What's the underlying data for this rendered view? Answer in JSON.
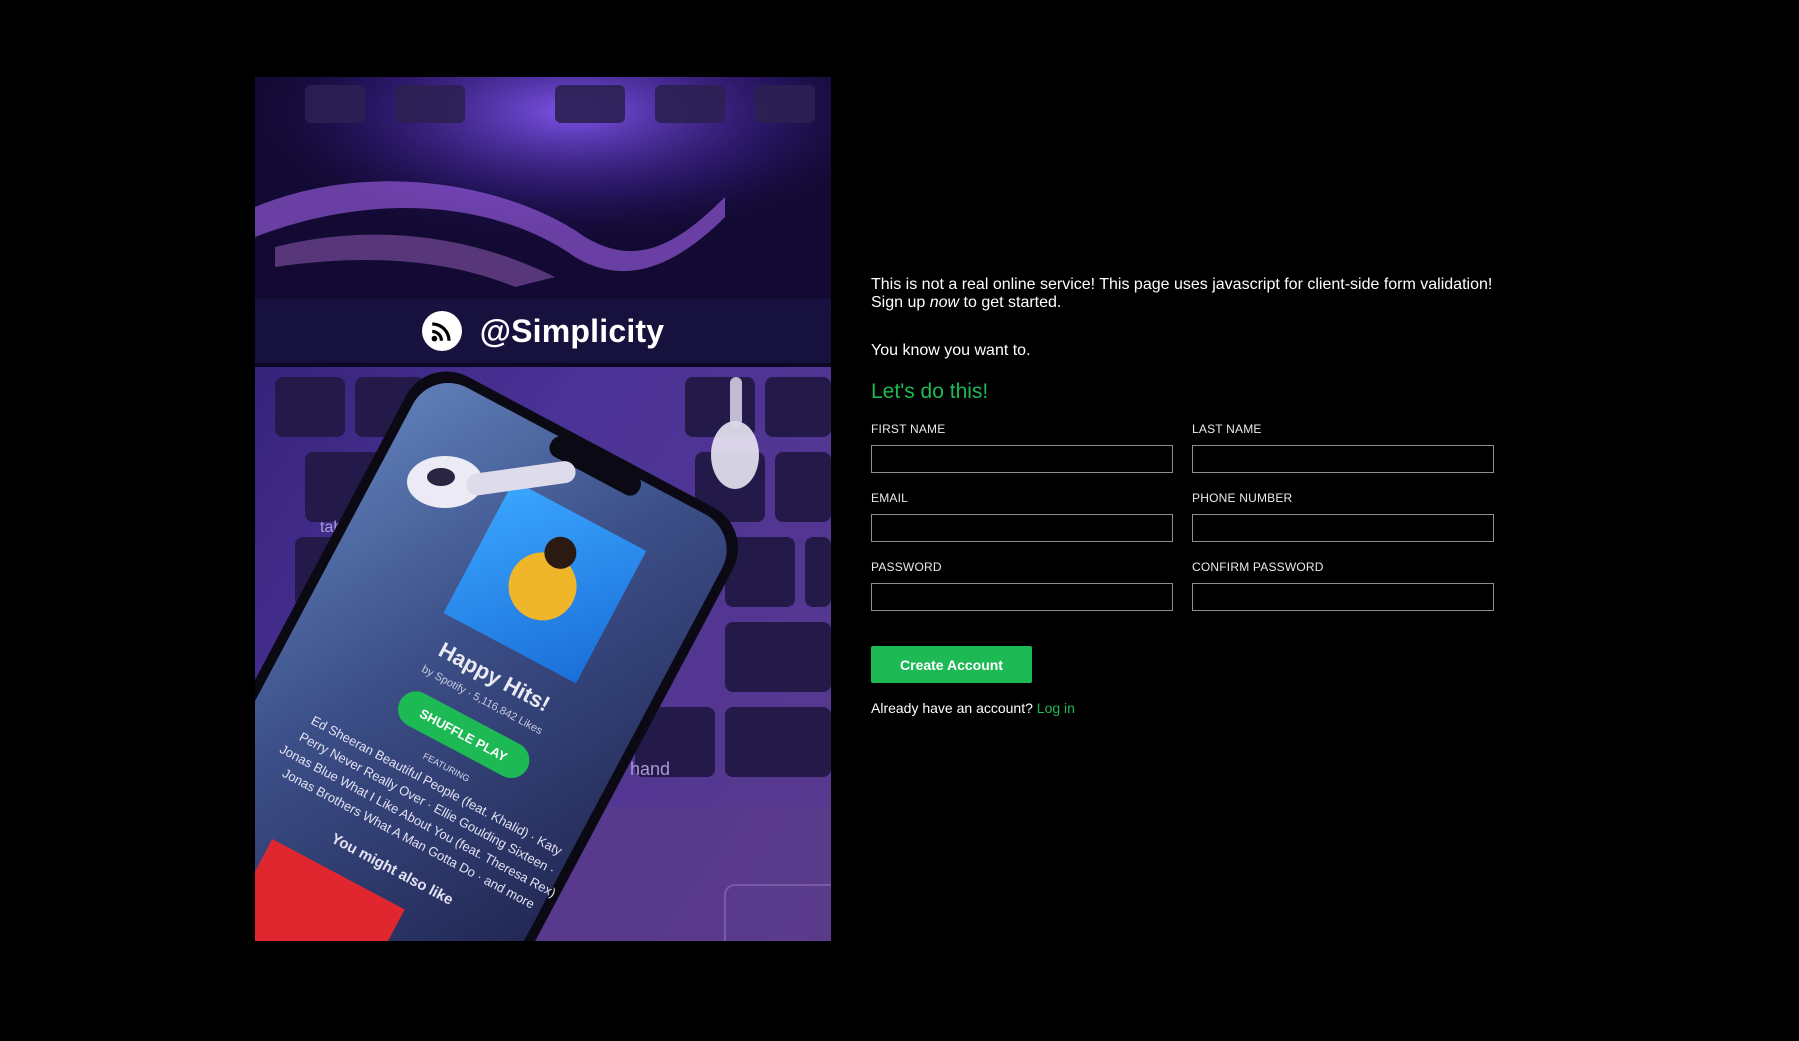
{
  "brand": {
    "logo_icon": "rss-feed-icon",
    "name": "@Simplicity"
  },
  "hero": {
    "image_icon": "phone-with-music-app-on-keyboard-image",
    "phone_playlist_title": "Happy Hits!",
    "phone_playlist_sub": "by Spotify · 5,116,842 Likes",
    "phone_button": "SHUFFLE PLAY",
    "phone_featuring": "FEATURING",
    "phone_tracks": [
      "Ed Sheeran Beautiful People (feat. Khalid) · Katy",
      "Perry Never Really Over · Ellie Goulding Sixteen ·",
      "Jonas Blue What I Like About You (feat. Theresa Rex)",
      "Jonas Brothers What A Man Gotta Do · and more"
    ],
    "phone_more": "You might also like",
    "key_labels": [
      "tab",
      "hand"
    ]
  },
  "intro": {
    "line1": "This is not a real online service! This page uses javascript for client-side form validation!",
    "line2_before": "Sign up ",
    "line2_em": "now",
    "line2_after": " to get started."
  },
  "intro2": "You know you want to.",
  "cta_title": "Let's do this!",
  "form": {
    "first_name": {
      "label": "FIRST NAME",
      "value": ""
    },
    "last_name": {
      "label": "LAST NAME",
      "value": ""
    },
    "email": {
      "label": "EMAIL",
      "value": ""
    },
    "phone": {
      "label": "PHONE NUMBER",
      "value": ""
    },
    "password": {
      "label": "PASSWORD",
      "value": ""
    },
    "confirm_password": {
      "label": "CONFIRM PASSWORD",
      "value": ""
    },
    "submit_label": "Create Account"
  },
  "login": {
    "prompt": "Already have an account?",
    "link_label": "Log in"
  },
  "colors": {
    "background": "#000000",
    "accent": "#1db954",
    "text": "#ffffff",
    "input_border": "#8f8f8f"
  }
}
